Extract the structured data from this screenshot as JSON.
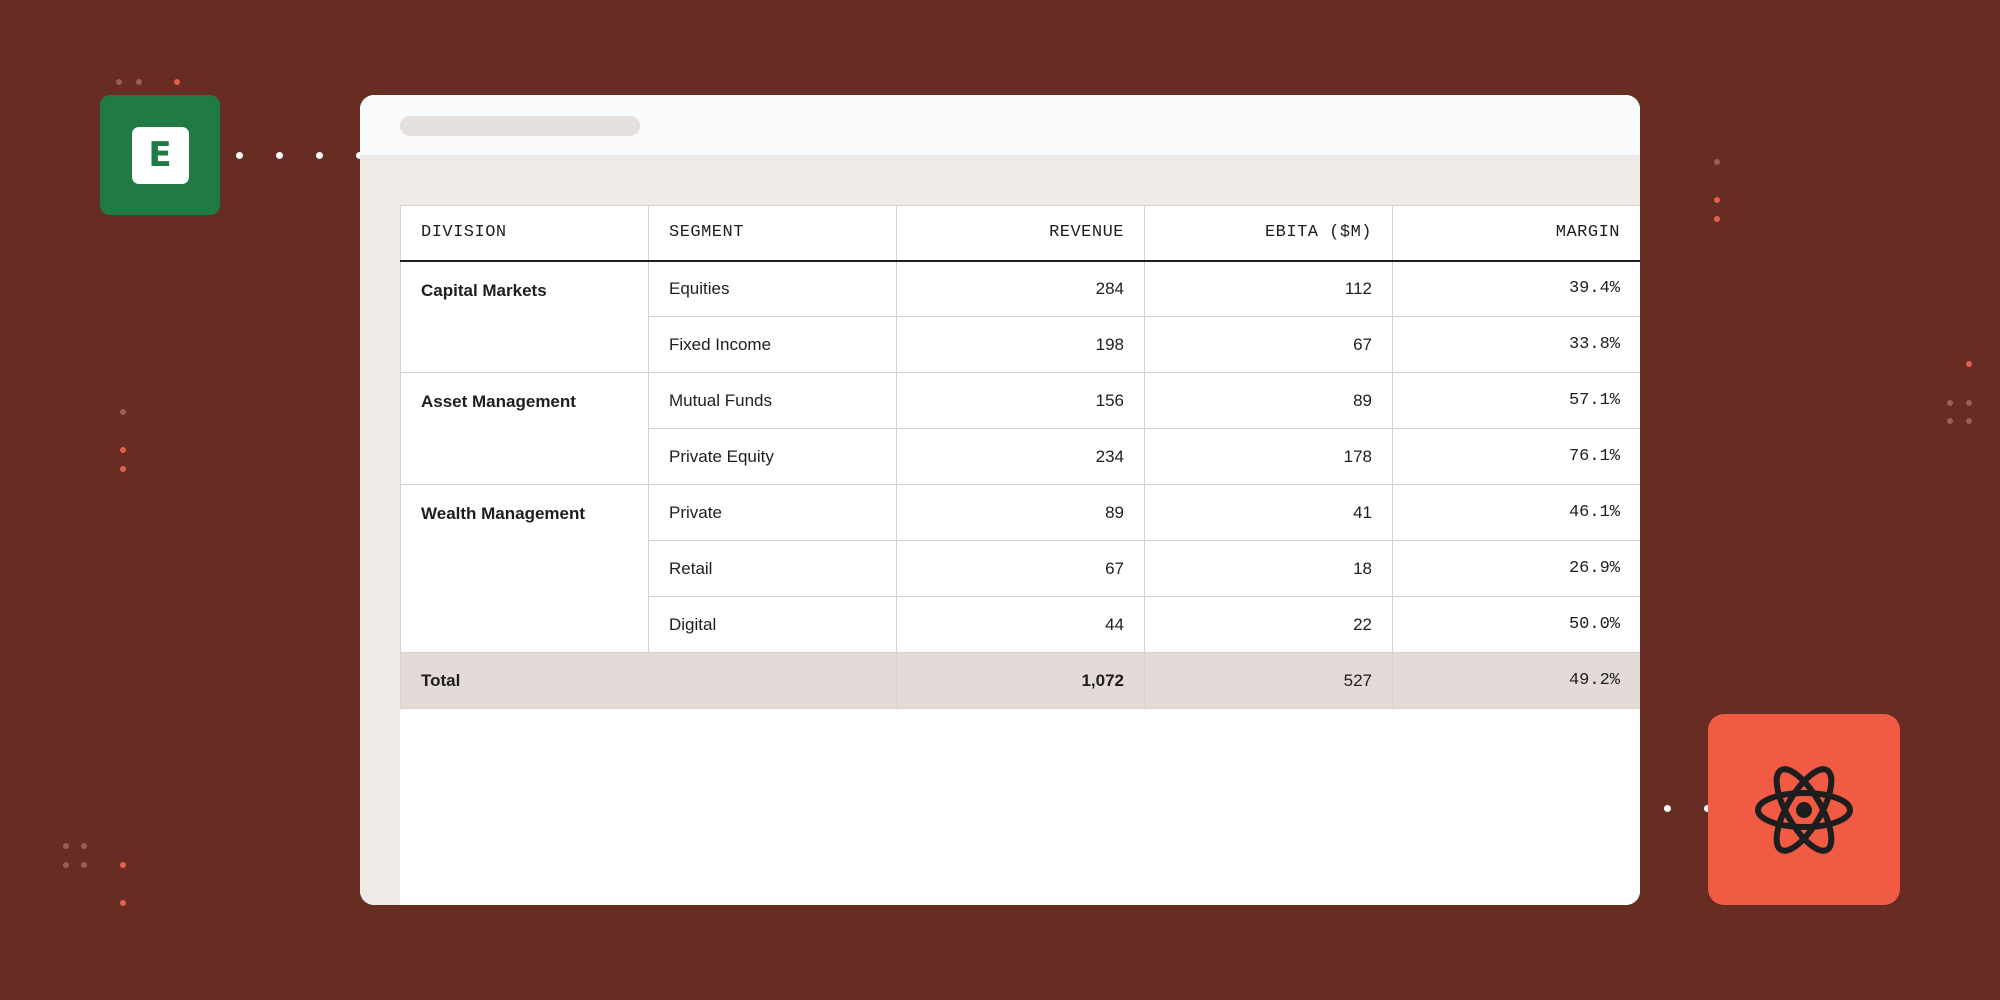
{
  "app": {
    "badge_letter": "E",
    "badge_icon": "spreadsheet-icon",
    "framework_icon": "react-atom-icon",
    "colors": {
      "background": "#672c22",
      "excel_green": "#1f7a44",
      "react_tile": "#f15b43",
      "total_row": "#e4dbd8"
    }
  },
  "table": {
    "headers": {
      "division": "DIVISION",
      "segment": "SEGMENT",
      "revenue": "REVENUE",
      "ebita": "EBITA ($M)",
      "margin": "MARGIN"
    },
    "groups": [
      {
        "division": "Capital Markets",
        "rows": [
          {
            "segment": "Equities",
            "revenue": "284",
            "ebita": "112",
            "margin": "39.4%"
          },
          {
            "segment": "Fixed Income",
            "revenue": "198",
            "ebita": "67",
            "margin": "33.8%"
          }
        ]
      },
      {
        "division": "Asset Management",
        "rows": [
          {
            "segment": "Mutual Funds",
            "revenue": "156",
            "ebita": "89",
            "margin": "57.1%"
          },
          {
            "segment": "Private Equity",
            "revenue": "234",
            "ebita": "178",
            "margin": "76.1%"
          }
        ]
      },
      {
        "division": "Wealth Management",
        "rows": [
          {
            "segment": "Private",
            "revenue": "89",
            "ebita": "41",
            "margin": "46.1%"
          },
          {
            "segment": "Retail",
            "revenue": "67",
            "ebita": "18",
            "margin": "26.9%"
          },
          {
            "segment": "Digital",
            "revenue": "44",
            "ebita": "22",
            "margin": "50.0%"
          }
        ]
      }
    ],
    "total": {
      "label": "Total",
      "revenue": "1,072",
      "ebita": "527",
      "margin": "49.2%"
    }
  }
}
